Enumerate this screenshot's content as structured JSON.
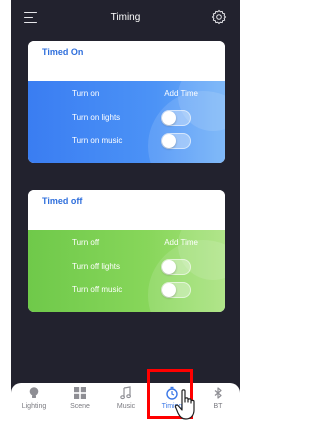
{
  "header": {
    "title": "Timing",
    "menu_icon": "menu-icon",
    "settings_icon": "gear-icon"
  },
  "timed_on": {
    "title": "Timed On",
    "turn_on_label": "Turn on",
    "add_time_label": "Add Time",
    "lights_label": "Turn on lights",
    "lights_enabled": false,
    "music_label": "Turn on music",
    "music_enabled": false
  },
  "timed_off": {
    "title": "Timed off",
    "turn_off_label": "Turn off",
    "add_time_label": "Add Time",
    "lights_label": "Turn off lights",
    "lights_enabled": false,
    "music_label": "Turn off music",
    "music_enabled": false
  },
  "tabbar": {
    "items": [
      {
        "label": "Lighting",
        "icon": "bulb-icon"
      },
      {
        "label": "Scene",
        "icon": "grid-icon"
      },
      {
        "label": "Music",
        "icon": "music-note-icon"
      },
      {
        "label": "Timing",
        "icon": "stopwatch-icon",
        "active": true
      },
      {
        "label": "BT",
        "icon": "bluetooth-icon"
      }
    ]
  },
  "colors": {
    "active_tab": "#3b78e7",
    "card_title": "#2f6fdc",
    "highlight_box": "#ff0000"
  }
}
